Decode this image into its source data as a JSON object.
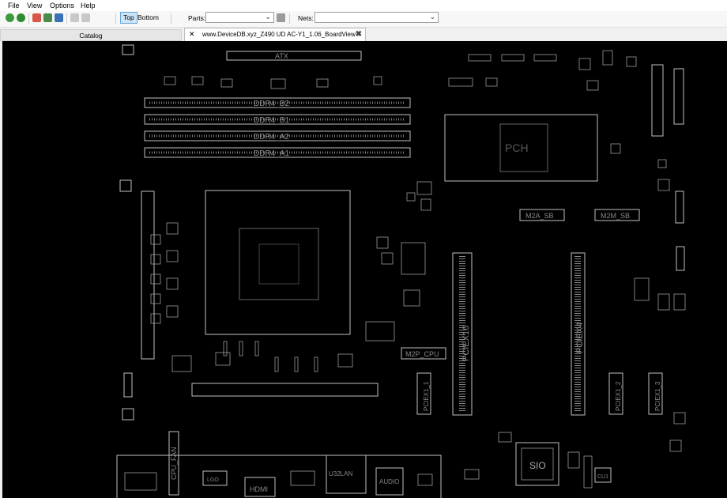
{
  "menu": {
    "file": "File",
    "view": "View",
    "options": "Options",
    "help": "Help"
  },
  "toolbar": {
    "top_label": "Top",
    "bottom_label": "Bottom",
    "parts_label": "Parts:",
    "parts_value": "",
    "nets_label": "Nets:",
    "nets_value": ""
  },
  "tabs": {
    "catalog_label": "Catalog",
    "board_tab_label": "www.DeviceDB.xyz_Z490 UD AC-Y1_1.06_BoardView"
  },
  "board": {
    "ddr4_b2": "DDR4_B2",
    "ddr4_b1": "DDR4_B1",
    "ddr4_a2": "DDR4_A2",
    "ddr4_a1": "DDR4_A1",
    "atx": "ATX",
    "pch": "PCH",
    "m2a_sb": "M2A_SB",
    "m2m_sb": "M2M_SB",
    "m2p_cpu": "M2P_CPU",
    "pciex16": "PCIEX16",
    "pciex4": "PCIEX4",
    "pciex1_1": "PCIEX1_1",
    "pciex1_2": "PCIEX1_2",
    "pciex1_3": "PCIEX1_3",
    "sio": "SIO",
    "hdmi": "HDMI",
    "audio": "AUDIO",
    "usb_lan": "U32LAN",
    "cpu_fan": "CPU_FAN",
    "cu1": "CU1",
    "lgo": "LGO"
  },
  "colors": {
    "board_bg": "#000000",
    "trace": "#bfbfbf",
    "label": "#8a8a8a",
    "tab_active_bg": "#cce4f7"
  }
}
